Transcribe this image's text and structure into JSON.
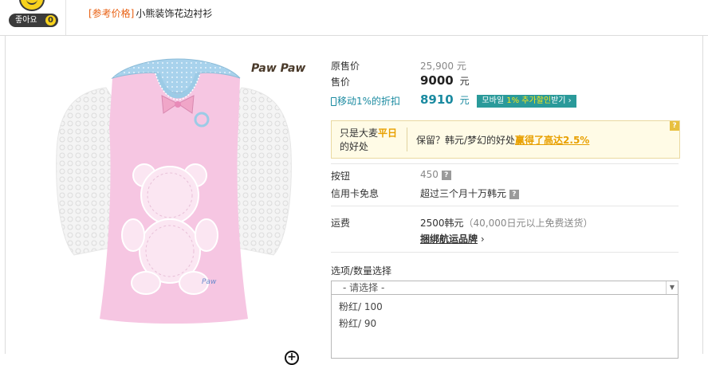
{
  "header": {
    "like_label": "좋아요",
    "like_count": "0",
    "ref_tag": "[参考价格]",
    "product_title": "小熊装饰花边衬衫"
  },
  "image": {
    "brand_logo": "Paw Paw",
    "zoom_icon": "zoom-plus-icon"
  },
  "pricing": {
    "original_label": "原售价",
    "original_value": "25,900",
    "original_unit": "元",
    "sale_label": "售价",
    "sale_value": "9000",
    "sale_unit": "元",
    "mobile_label": "移动1%的折扣",
    "mobile_value": "8910",
    "mobile_unit": "元",
    "mobile_button_pre": "모바일",
    "mobile_button_hl": "1% 추가할인",
    "mobile_button_post": "받기 ›"
  },
  "benefit": {
    "left_line1_pre": "只是大麦",
    "left_line1_hot": "平日",
    "left_line2": "的好处",
    "right_pre": "保留？韩元/梦幻的好处",
    "right_link": "赢得了高达2.5%"
  },
  "details": {
    "button_label": "按钮",
    "button_value": "450",
    "credit_label": "信用卡免息",
    "credit_value": "超过三个月十万韩元",
    "shipping_label": "运费",
    "shipping_value": "2500韩元",
    "shipping_note": "（40,000日元以上免费送货）",
    "shipping_link": "捆绑航运品牌",
    "shipping_link_arrow": "›"
  },
  "options": {
    "section_label": "选项/数量选择",
    "placeholder": "- 请选择 -",
    "items": [
      "粉红/ 100",
      "粉红/ 90"
    ]
  },
  "colors": {
    "accent_orange": "#e85f10",
    "teal": "#1a8aa0",
    "highlight_yellow": "#f5e61a"
  }
}
